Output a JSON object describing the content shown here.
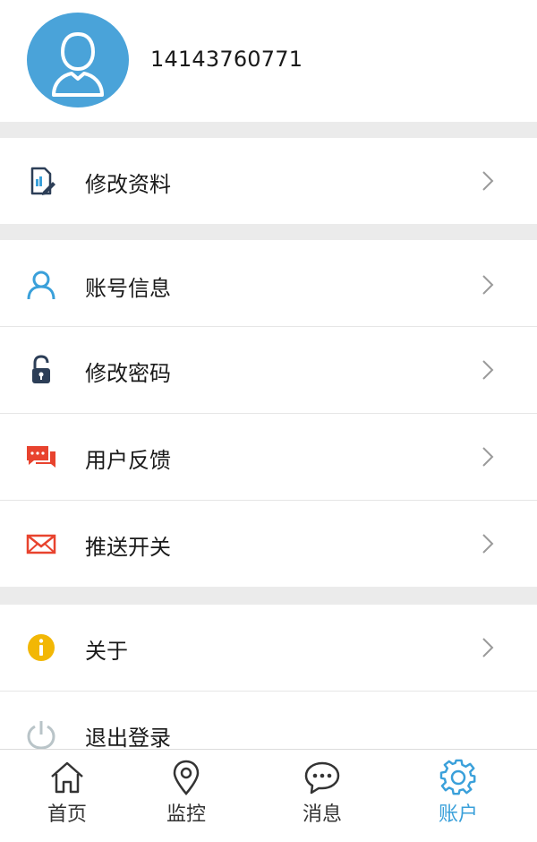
{
  "profile": {
    "phone": "14143760771"
  },
  "menu": {
    "edit_profile": "修改资料",
    "account_info": "账号信息",
    "change_password": "修改密码",
    "feedback": "用户反馈",
    "push_switch": "推送开关",
    "about": "关于",
    "logout": "退出登录"
  },
  "tabbar": {
    "home": "首页",
    "monitor": "监控",
    "messages": "消息",
    "account": "账户",
    "active": "account"
  },
  "colors": {
    "accent": "#3aa0da",
    "avatar_bg": "#4aa3d9",
    "feedback_red": "#e8432e",
    "about_yellow": "#f2b705",
    "section_gap": "#ebebeb"
  },
  "icons": {
    "avatar": "user-silhouette-icon",
    "edit_profile": "edit-document-icon",
    "account_info": "user-icon",
    "change_password": "lock-icon",
    "feedback": "chat-bubbles-icon",
    "push_switch": "envelope-icon",
    "about": "info-icon",
    "logout": "power-icon",
    "chevron": "chevron-right-icon",
    "home": "home-icon",
    "monitor": "location-pin-icon",
    "messages": "chat-bubble-icon",
    "account": "gear-icon"
  }
}
